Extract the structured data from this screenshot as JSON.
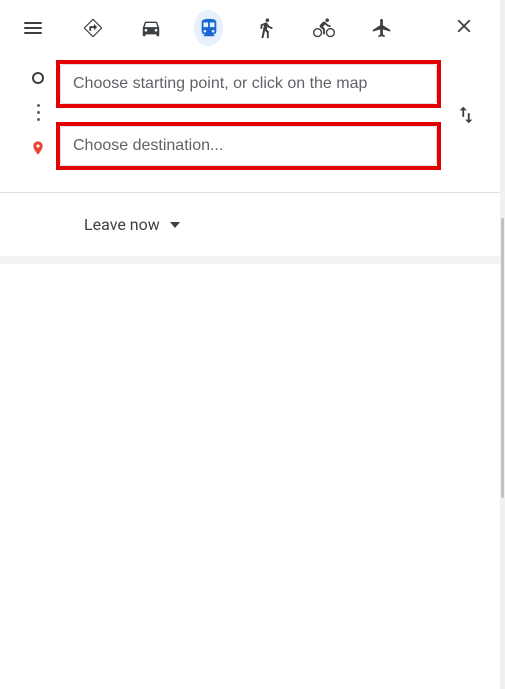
{
  "transit_modes": {
    "best": "Best travel modes",
    "driving": "Driving",
    "transit": "Transit",
    "walking": "Walking",
    "cycling": "Cycling",
    "flights": "Flights"
  },
  "inputs": {
    "start_placeholder": "Choose starting point, or click on the map",
    "destination_placeholder": "Choose destination...",
    "start_value": "",
    "destination_value": ""
  },
  "schedule": {
    "leave_now_label": "Leave now"
  },
  "actions": {
    "menu": "Menu",
    "close": "Close directions",
    "swap": "Reverse starting point and destination"
  }
}
